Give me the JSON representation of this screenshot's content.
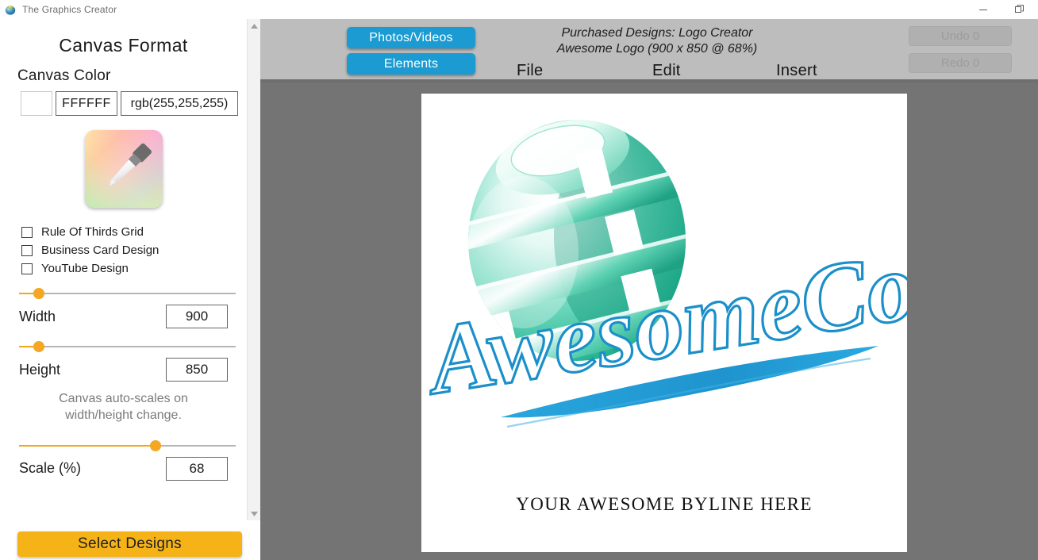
{
  "window": {
    "title": "The Graphics Creator",
    "app_icon": "sphere-logo-icon",
    "controls": {
      "minimize": "minimize-icon",
      "restore": "restore-icon"
    }
  },
  "panel": {
    "title": "Canvas Format",
    "canvas_color": {
      "label": "Canvas Color",
      "swatch_hex": "#FFFFFF",
      "hex_value": "FFFFFF",
      "rgb_value": "rgb(255,255,255)"
    },
    "picker_icon": "eyedropper-color-picker-icon",
    "checkboxes": [
      {
        "label": "Rule Of Thirds Grid",
        "checked": false
      },
      {
        "label": "Business Card Design",
        "checked": false
      },
      {
        "label": "YouTube Design",
        "checked": false
      }
    ],
    "width": {
      "label": "Width",
      "value": "900",
      "slider_percent": 9
    },
    "height": {
      "label": "Height",
      "value": "850",
      "slider_percent": 9
    },
    "note": "Canvas auto-scales on width/height change.",
    "scale": {
      "label": "Scale (%)",
      "value": "68",
      "slider_percent": 63
    },
    "select_designs_label": "Select Designs",
    "scrollbar": {
      "up_arrow": "scroll-up-arrow-icon",
      "down_arrow": "scroll-down-arrow-icon"
    }
  },
  "toolbar": {
    "photos_videos_label": "Photos/Videos",
    "elements_label": "Elements",
    "purchased_line1": "Purchased Designs: Logo Creator",
    "purchased_line2": "Awesome Logo  (900 x 850 @ 68%)",
    "menus": [
      {
        "label": "File"
      },
      {
        "label": "Edit"
      },
      {
        "label": "Insert"
      }
    ],
    "undo_label": "Undo 0",
    "redo_label": "Redo 0",
    "accent_blue": "#1B9BD1",
    "accent_amber": "#F5B318"
  },
  "canvas": {
    "background": "#FFFFFF",
    "logo_sphere_color": "#3FC4A8",
    "logo_text": "AwesomeCo.",
    "logo_text_color": "#1B8FC9",
    "byline": "YOUR AWESOME BYLINE HERE"
  }
}
